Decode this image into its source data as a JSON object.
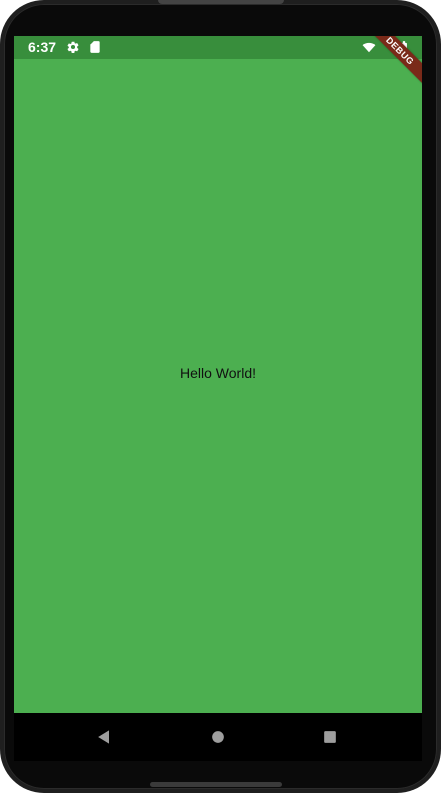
{
  "status_bar": {
    "time": "6:37",
    "left_icons": [
      "settings-icon",
      "sd-card-icon"
    ],
    "right_icons": [
      "wifi-icon",
      "battery-icon"
    ]
  },
  "debug_banner": {
    "label": "DEBUG"
  },
  "content": {
    "text": "Hello World!"
  },
  "navigation": {
    "buttons": [
      "back-button",
      "home-button",
      "recents-button"
    ]
  },
  "colors": {
    "status_bar": "#388e3c",
    "app_background": "#4caf50",
    "debug_ribbon": "#7a2a19",
    "nav_bar": "#000000"
  }
}
